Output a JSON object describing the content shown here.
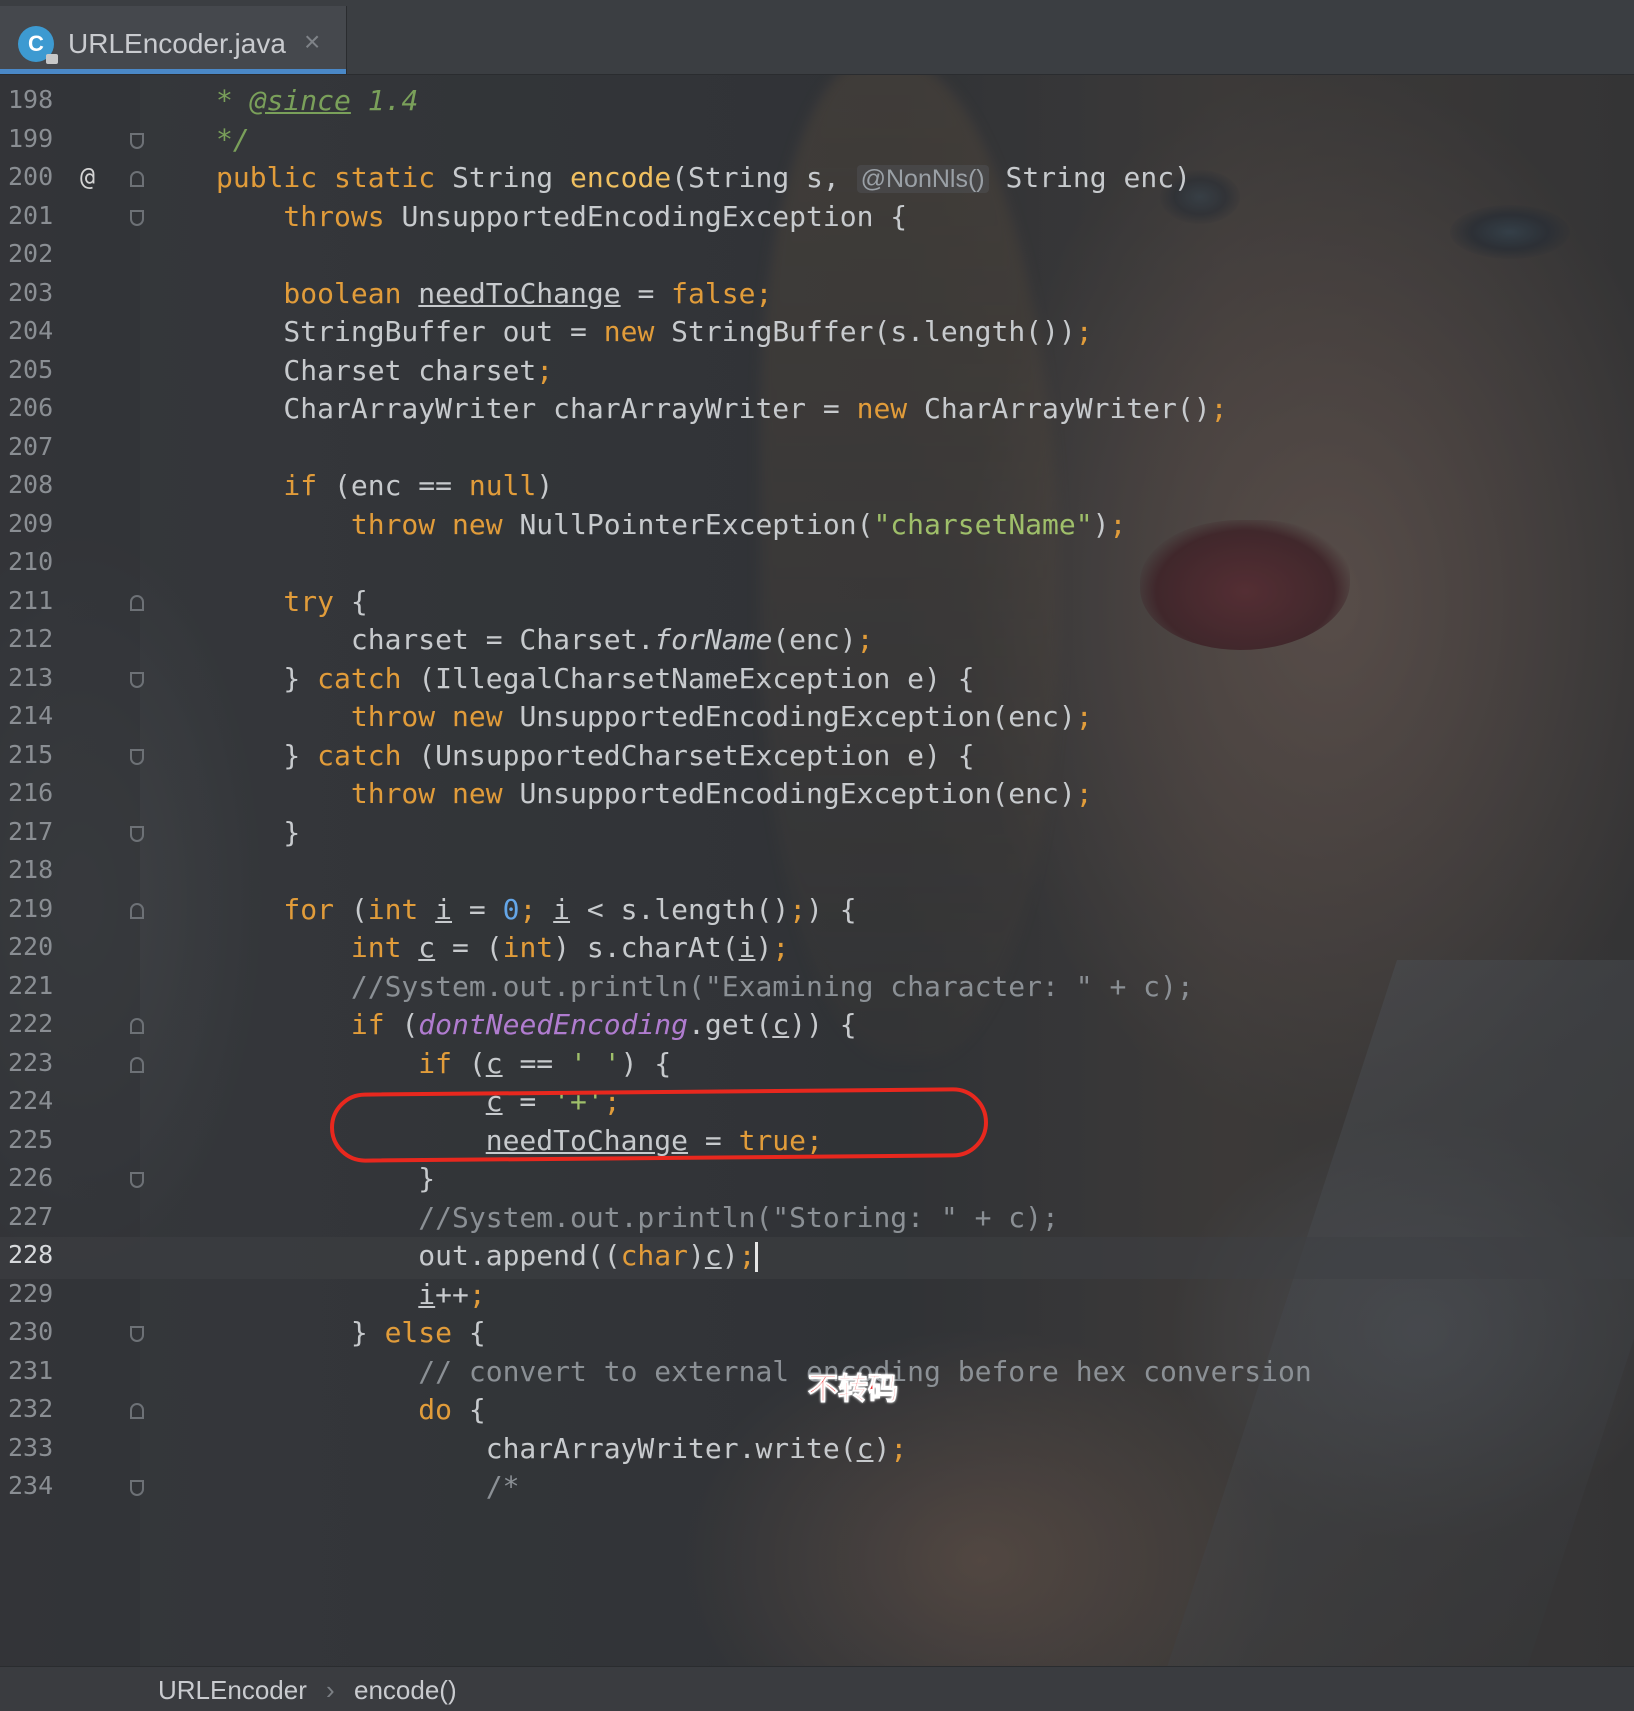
{
  "tab": {
    "title": "URLEncoder.java",
    "icon": "C",
    "close": "×"
  },
  "editor": {
    "lines": [
      {
        "n": "198",
        "code": [
          [
            "doc",
            "* "
          ],
          [
            "doctag",
            "@since"
          ],
          [
            "doc",
            " 1.4"
          ]
        ]
      },
      {
        "n": "199",
        "code": [
          [
            "doc",
            "*/"
          ]
        ]
      },
      {
        "n": "200",
        "code": [
          [
            "kw",
            "public static "
          ],
          [
            "",
            "String "
          ],
          [
            "fn",
            "encode"
          ],
          [
            "",
            "(String s, "
          ],
          [
            "anno",
            "@NonNls()"
          ],
          [
            "",
            " String enc)"
          ]
        ]
      },
      {
        "n": "201",
        "code": [
          [
            "kw",
            "    throws "
          ],
          [
            "",
            "UnsupportedEncodingException {"
          ]
        ]
      },
      {
        "n": "202",
        "code": []
      },
      {
        "n": "203",
        "code": [
          [
            "kw",
            "    boolean "
          ],
          [
            "ul",
            "needToChange"
          ],
          [
            "",
            " = "
          ],
          [
            "kw",
            "false;"
          ]
        ]
      },
      {
        "n": "204",
        "code": [
          [
            "",
            "    StringBuffer out = "
          ],
          [
            "kw",
            "new "
          ],
          [
            "",
            "StringBuffer(s.length())"
          ],
          [
            "kw",
            ";"
          ]
        ]
      },
      {
        "n": "205",
        "code": [
          [
            "",
            "    Charset charset"
          ],
          [
            "kw",
            ";"
          ]
        ]
      },
      {
        "n": "206",
        "code": [
          [
            "",
            "    CharArrayWriter charArrayWriter = "
          ],
          [
            "kw",
            "new "
          ],
          [
            "",
            "CharArrayWriter()"
          ],
          [
            "kw",
            ";"
          ]
        ]
      },
      {
        "n": "207",
        "code": []
      },
      {
        "n": "208",
        "code": [
          [
            "kw",
            "    if "
          ],
          [
            "",
            "(enc == "
          ],
          [
            "kw",
            "null"
          ],
          [
            "",
            ")"
          ]
        ]
      },
      {
        "n": "209",
        "code": [
          [
            "kw",
            "        throw new "
          ],
          [
            "",
            "NullPointerException("
          ],
          [
            "str",
            "\"charsetName\""
          ],
          [
            "",
            ")"
          ],
          [
            "kw",
            ";"
          ]
        ]
      },
      {
        "n": "210",
        "code": []
      },
      {
        "n": "211",
        "code": [
          [
            "kw",
            "    try "
          ],
          [
            "",
            "{"
          ]
        ]
      },
      {
        "n": "212",
        "code": [
          [
            "",
            "        charset = Charset."
          ],
          [
            "it",
            "forName"
          ],
          [
            "",
            "(enc)"
          ],
          [
            "kw",
            ";"
          ]
        ]
      },
      {
        "n": "213",
        "code": [
          [
            "",
            "    } "
          ],
          [
            "kw",
            "catch "
          ],
          [
            "",
            "(IllegalCharsetNameException e) {"
          ]
        ]
      },
      {
        "n": "214",
        "code": [
          [
            "kw",
            "        throw new "
          ],
          [
            "",
            "UnsupportedEncodingException(enc)"
          ],
          [
            "kw",
            ";"
          ]
        ]
      },
      {
        "n": "215",
        "code": [
          [
            "",
            "    } "
          ],
          [
            "kw",
            "catch "
          ],
          [
            "",
            "(UnsupportedCharsetException e) {"
          ]
        ]
      },
      {
        "n": "216",
        "code": [
          [
            "kw",
            "        throw new "
          ],
          [
            "",
            "UnsupportedEncodingException(enc)"
          ],
          [
            "kw",
            ";"
          ]
        ]
      },
      {
        "n": "217",
        "code": [
          [
            "",
            "    }"
          ]
        ]
      },
      {
        "n": "218",
        "code": []
      },
      {
        "n": "219",
        "code": [
          [
            "kw",
            "    for "
          ],
          [
            "",
            "("
          ],
          [
            "kw",
            "int "
          ],
          [
            "ul",
            "i"
          ],
          [
            "",
            " = "
          ],
          [
            "num",
            "0"
          ],
          [
            "kw",
            "; "
          ],
          [
            "ul",
            "i"
          ],
          [
            "",
            " < s.length()"
          ],
          [
            "kw",
            ";"
          ],
          [
            "",
            ") {"
          ]
        ]
      },
      {
        "n": "220",
        "code": [
          [
            "kw",
            "        int "
          ],
          [
            "ul",
            "c"
          ],
          [
            "",
            " = ("
          ],
          [
            "kw",
            "int"
          ],
          [
            "",
            ") s.charAt("
          ],
          [
            "ul",
            "i"
          ],
          [
            "",
            ")"
          ],
          [
            "kw",
            ";"
          ]
        ]
      },
      {
        "n": "221",
        "code": [
          [
            "cmt",
            "        //System.out.println(\"Examining character: \" + c);"
          ]
        ]
      },
      {
        "n": "222",
        "code": [
          [
            "kw",
            "        if "
          ],
          [
            "",
            "("
          ],
          [
            "field",
            "dontNeedEncoding"
          ],
          [
            "",
            ".get("
          ],
          [
            "ul",
            "c"
          ],
          [
            "",
            ")) {"
          ]
        ]
      },
      {
        "n": "223",
        "code": [
          [
            "kw",
            "            if "
          ],
          [
            "",
            "("
          ],
          [
            "ul",
            "c"
          ],
          [
            "",
            " == "
          ],
          [
            "str",
            "' '"
          ],
          [
            "",
            ") {"
          ]
        ]
      },
      {
        "n": "224",
        "code": [
          [
            "",
            "                "
          ],
          [
            "ul",
            "c"
          ],
          [
            "",
            " = "
          ],
          [
            "str",
            "'+'"
          ],
          [
            "kw",
            ";"
          ]
        ]
      },
      {
        "n": "225",
        "code": [
          [
            "",
            "                "
          ],
          [
            "ul",
            "needToChange"
          ],
          [
            "",
            " = "
          ],
          [
            "kw",
            "true;"
          ]
        ]
      },
      {
        "n": "226",
        "code": [
          [
            "",
            "            }"
          ]
        ]
      },
      {
        "n": "227",
        "code": [
          [
            "cmt",
            "            //System.out.println(\"Storing: \" + c);"
          ]
        ]
      },
      {
        "n": "228",
        "code": [
          [
            "",
            "            out.append(("
          ],
          [
            "kw",
            "char"
          ],
          [
            "",
            ")"
          ],
          [
            "ul",
            "c"
          ],
          [
            "",
            ")"
          ],
          [
            "kw",
            ";"
          ],
          [
            "caret",
            ""
          ]
        ]
      },
      {
        "n": "229",
        "code": [
          [
            "",
            "            "
          ],
          [
            "ul",
            "i"
          ],
          [
            "",
            "++"
          ],
          [
            "kw",
            ";"
          ]
        ]
      },
      {
        "n": "230",
        "code": [
          [
            "",
            "        } "
          ],
          [
            "kw",
            "else "
          ],
          [
            "",
            "{"
          ]
        ]
      },
      {
        "n": "231",
        "code": [
          [
            "cmt",
            "            // convert to external encoding before hex conversion"
          ]
        ]
      },
      {
        "n": "232",
        "code": [
          [
            "kw",
            "            do "
          ],
          [
            "",
            "{"
          ]
        ]
      },
      {
        "n": "233",
        "code": [
          [
            "",
            "                charArrayWriter.write("
          ],
          [
            "ul",
            "c"
          ],
          [
            "",
            ")"
          ],
          [
            "kw",
            ";"
          ]
        ]
      },
      {
        "n": "234",
        "code": [
          [
            "cmt",
            "                /*"
          ]
        ]
      }
    ]
  },
  "annotation": {
    "note": "不转码",
    "color": "#e8281e"
  },
  "breadcrumb": {
    "class_name": "URLEncoder",
    "separator": "›",
    "method": "encode()"
  },
  "colors": {
    "keyword": "#e19c3a",
    "string": "#9fbf6a",
    "comment": "#8b9095",
    "field": "#b07ccf",
    "accent_tab": "#4a88c7"
  }
}
